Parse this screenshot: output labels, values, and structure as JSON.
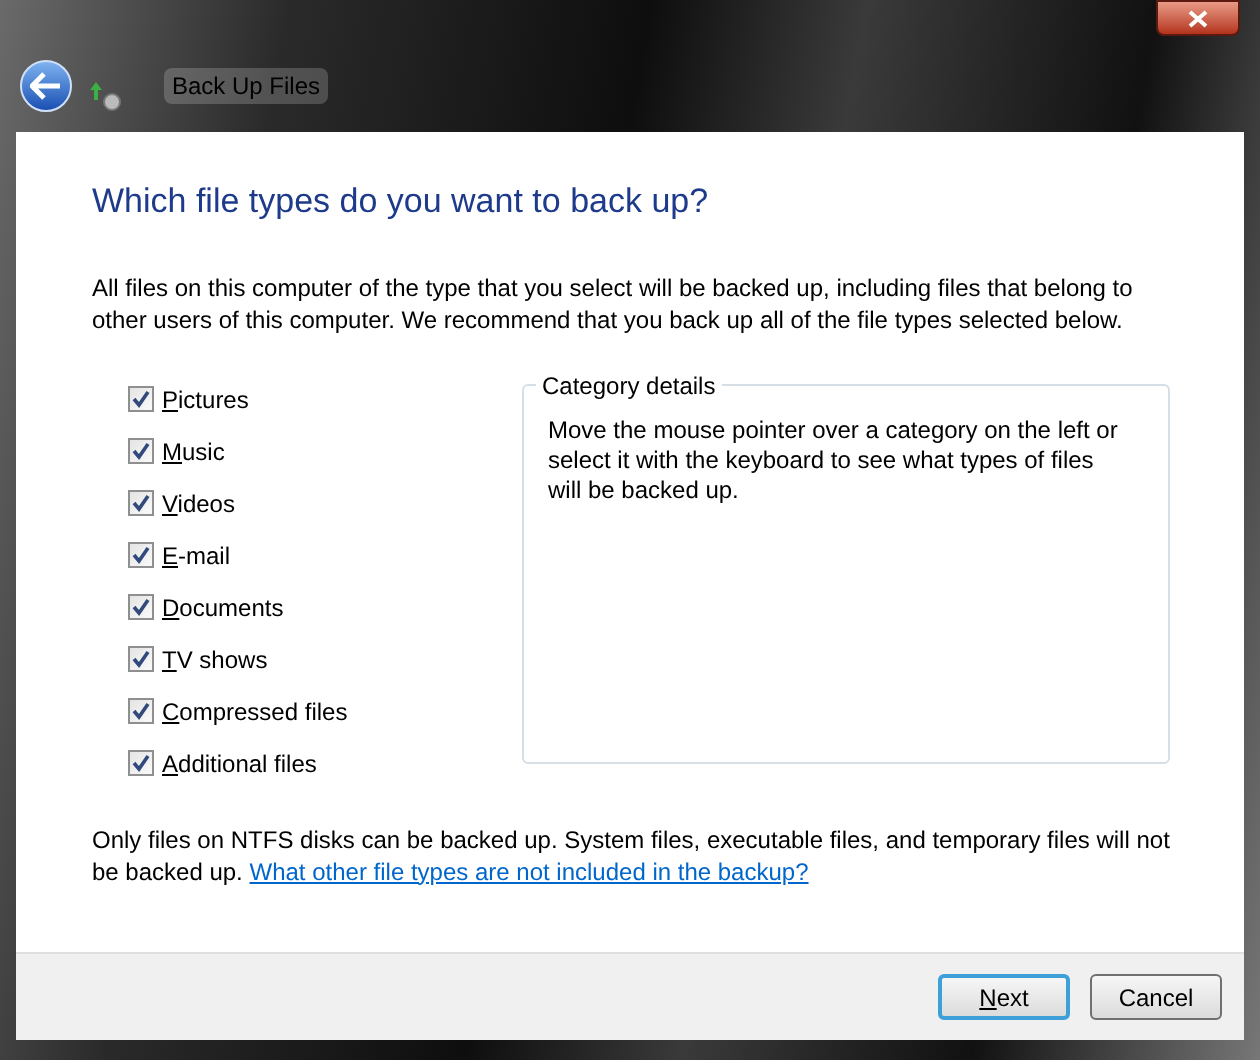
{
  "window": {
    "title": "Back Up Files"
  },
  "heading": "Which file types do you want to back up?",
  "intro": "All files on this computer of the type that you select will be backed up, including files that belong to other users of this computer. We recommend that you back up all of the file types selected below.",
  "categories": [
    {
      "label": "Pictures",
      "checked": true,
      "first_letter_underlined": true
    },
    {
      "label": "Music",
      "checked": true,
      "first_letter_underlined": true
    },
    {
      "label": "Videos",
      "checked": true,
      "first_letter_underlined": true
    },
    {
      "label": "E-mail",
      "checked": true,
      "first_letter_underlined": true
    },
    {
      "label": "Documents",
      "checked": true,
      "first_letter_underlined": true
    },
    {
      "label": "TV shows",
      "checked": true,
      "first_letter_underlined": true
    },
    {
      "label": "Compressed files",
      "checked": true,
      "first_letter_underlined": true
    },
    {
      "label": "Additional files",
      "checked": true,
      "first_letter_underlined": true
    }
  ],
  "details": {
    "title": "Category details",
    "text": "Move the mouse pointer over a category on the left or select it with the keyboard to see what types of files will be backed up."
  },
  "note": {
    "text": "Only files on NTFS disks can be backed up. System files, executable files, and temporary files will not be backed up.",
    "link": "What other file types are not included in the backup?"
  },
  "buttons": [
    {
      "label": "Next",
      "first_letter_underlined": true,
      "default": true
    },
    {
      "label": "Cancel",
      "first_letter_underlined": false,
      "default": false
    }
  ]
}
